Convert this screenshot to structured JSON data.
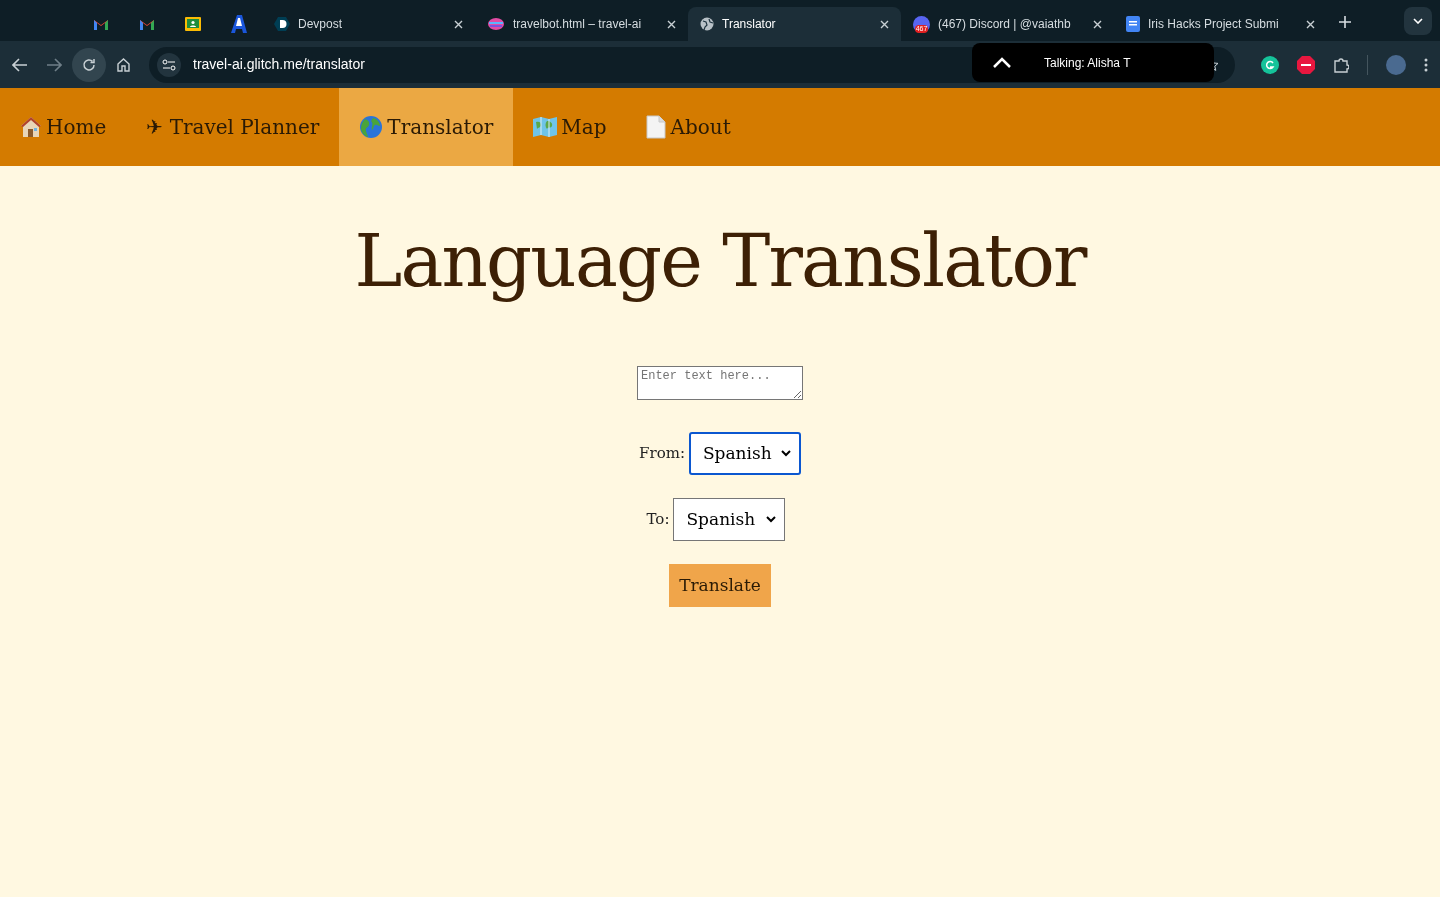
{
  "browser": {
    "tabs": [
      {
        "kind": "gmail",
        "selected": false
      },
      {
        "kind": "gmail",
        "selected": false
      },
      {
        "kind": "classroom",
        "selected": false
      },
      {
        "kind": "letter-a",
        "selected": false
      },
      {
        "kind": "devpost",
        "title": "Devpost",
        "selected": false
      },
      {
        "kind": "glitch",
        "title": "travelbot.html – travel-ai",
        "selected": false
      },
      {
        "kind": "globe",
        "title": "Translator",
        "selected": true
      },
      {
        "kind": "discord",
        "title": "(467) Discord | @vaiathb",
        "badge": "467",
        "selected": false
      },
      {
        "kind": "docs",
        "title": "Iris Hacks Project Submi",
        "selected": false
      }
    ],
    "url": "travel-ai.glitch.me/translator",
    "popup": "Talking: Alisha T"
  },
  "nav": [
    {
      "kind": "home",
      "label": "Home",
      "selected": false
    },
    {
      "kind": "text",
      "label": "✈ Travel Planner",
      "selected": false
    },
    {
      "kind": "globe",
      "label": "Translator",
      "selected": true
    },
    {
      "kind": "map",
      "label": "Map",
      "selected": false
    },
    {
      "kind": "page",
      "label": "About",
      "selected": false
    }
  ],
  "title": "Language Translator",
  "input": {
    "placeholder": "Enter text here..."
  },
  "from": {
    "label": "From:",
    "value": "Spanish",
    "focused": true
  },
  "to": {
    "label": "To:",
    "value": "Spanish",
    "focused": false
  },
  "button": "Translate"
}
